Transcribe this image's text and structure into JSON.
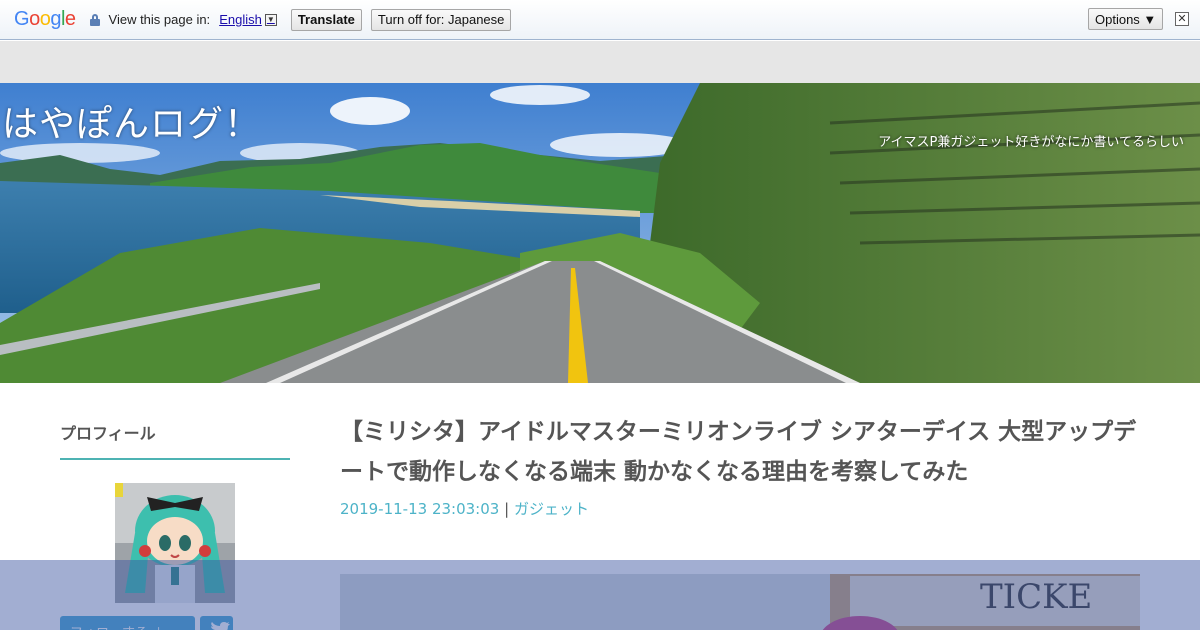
{
  "translate_bar": {
    "logo": "Google",
    "view_text": "View this page in:",
    "language": "English",
    "language_arrow": "▼",
    "translate_label": "Translate",
    "turn_off_label": "Turn off for: Japanese",
    "options_label": "Options ▼",
    "close_glyph": "✕"
  },
  "site": {
    "title": "はやぽんログ！",
    "description": "アイマスP兼ガジェット好きがなにか書いてるらしい"
  },
  "sidebar": {
    "heading": "プロフィール",
    "follow_label": "フォローする ＋"
  },
  "article": {
    "title": "【ミリシタ】アイドルマスターミリオンライブ シアターデイス 大型アップデートで動作しなくなる端末 動かなくなる理由を考察してみた",
    "date": "2019-11-13 23:03:03",
    "separator": "|",
    "category": "ガジェット",
    "image_text": "TICKE"
  },
  "colors": {
    "accent": "#4db3b3",
    "link": "#4db3c8",
    "button": "#4aa9d6",
    "overlay": "#3c56a0"
  }
}
